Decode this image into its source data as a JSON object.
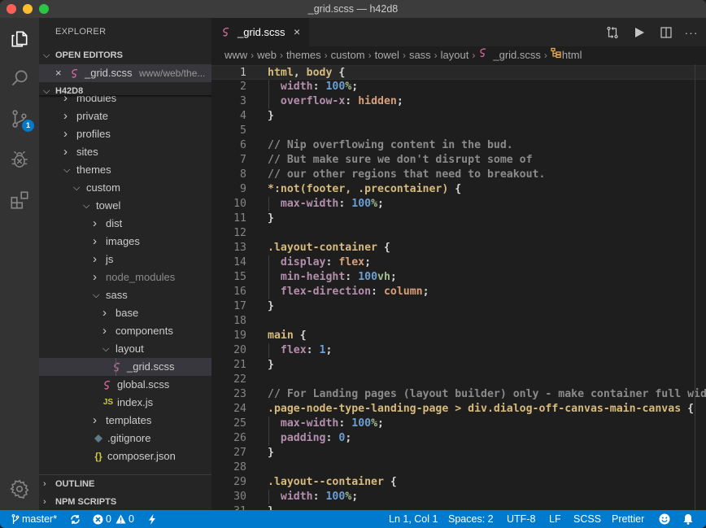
{
  "window": {
    "title": "_grid.scss — h42d8"
  },
  "activity_bar": {
    "items": [
      {
        "name": "explorer",
        "icon": "files-icon"
      },
      {
        "name": "search",
        "icon": "search-icon"
      },
      {
        "name": "source-control",
        "icon": "source-control-icon",
        "badge": "1"
      },
      {
        "name": "debug",
        "icon": "debug-icon"
      },
      {
        "name": "extensions",
        "icon": "extensions-icon"
      }
    ],
    "bottom": {
      "name": "manage",
      "icon": "gear-icon"
    }
  },
  "sidebar": {
    "title": "EXPLORER",
    "open_editors": {
      "header": "OPEN EDITORS",
      "items": [
        {
          "name": "_grid.scss",
          "path": "www/web/the...",
          "icon": "sass-icon"
        }
      ]
    },
    "folder": {
      "header": "H42D8",
      "tree": [
        {
          "label": "modules",
          "type": "folder",
          "expanded": false,
          "depth": 1
        },
        {
          "label": "private",
          "type": "folder",
          "expanded": false,
          "depth": 1
        },
        {
          "label": "profiles",
          "type": "folder",
          "expanded": false,
          "depth": 1
        },
        {
          "label": "sites",
          "type": "folder",
          "expanded": false,
          "depth": 1
        },
        {
          "label": "themes",
          "type": "folder",
          "expanded": true,
          "depth": 1
        },
        {
          "label": "custom",
          "type": "folder",
          "expanded": true,
          "depth": 2
        },
        {
          "label": "towel",
          "type": "folder",
          "expanded": true,
          "depth": 3
        },
        {
          "label": "dist",
          "type": "folder",
          "expanded": false,
          "depth": 4
        },
        {
          "label": "images",
          "type": "folder",
          "expanded": false,
          "depth": 4
        },
        {
          "label": "js",
          "type": "folder",
          "expanded": false,
          "depth": 4
        },
        {
          "label": "node_modules",
          "type": "folder",
          "expanded": false,
          "depth": 4,
          "dimmed": true
        },
        {
          "label": "sass",
          "type": "folder",
          "expanded": true,
          "depth": 4
        },
        {
          "label": "base",
          "type": "folder",
          "expanded": false,
          "depth": 5
        },
        {
          "label": "components",
          "type": "folder",
          "expanded": false,
          "depth": 5
        },
        {
          "label": "layout",
          "type": "folder",
          "expanded": true,
          "depth": 5
        },
        {
          "label": "_grid.scss",
          "type": "scss",
          "depth": 6,
          "selected": true
        },
        {
          "label": "global.scss",
          "type": "scss",
          "depth": 5
        },
        {
          "label": "index.js",
          "type": "js",
          "depth": 5
        },
        {
          "label": "templates",
          "type": "folder",
          "expanded": false,
          "depth": 4
        },
        {
          "label": ".gitignore",
          "type": "git",
          "depth": 4
        },
        {
          "label": "composer.json",
          "type": "json",
          "depth": 4
        }
      ]
    },
    "outline": {
      "header": "OUTLINE"
    },
    "npm_scripts": {
      "header": "NPM SCRIPTS"
    }
  },
  "editor": {
    "tab": {
      "name": "_grid.scss",
      "icon": "sass-icon"
    },
    "actions": [
      {
        "name": "open-changes",
        "icon": "git-compare-icon"
      },
      {
        "name": "run",
        "icon": "play-icon"
      },
      {
        "name": "split-editor",
        "icon": "split-editor-icon"
      },
      {
        "name": "more-actions",
        "icon": "ellipsis-icon"
      }
    ],
    "breadcrumb": [
      "www",
      "web",
      "themes",
      "custom",
      "towel",
      "sass",
      "layout",
      "_grid.scss",
      "html"
    ],
    "current_line": 1,
    "lines": [
      [
        [
          "sel",
          "html"
        ],
        [
          "pun",
          ", "
        ],
        [
          "sel",
          "body"
        ],
        [
          "pun",
          " {"
        ]
      ],
      [
        [
          "pun",
          "  "
        ],
        [
          "prop",
          "width"
        ],
        [
          "pun",
          ": "
        ],
        [
          "num",
          "100"
        ],
        [
          "unit",
          "%"
        ],
        [
          "pun",
          ";"
        ]
      ],
      [
        [
          "pun",
          "  "
        ],
        [
          "prop",
          "overflow-x"
        ],
        [
          "pun",
          ": "
        ],
        [
          "val",
          "hidden"
        ],
        [
          "pun",
          ";"
        ]
      ],
      [
        [
          "pun",
          "}"
        ]
      ],
      [],
      [
        [
          "com",
          "// Nip overflowing content in the bud."
        ]
      ],
      [
        [
          "com",
          "// But make sure we don't disrupt some of"
        ]
      ],
      [
        [
          "com",
          "// our other regions that need to breakout."
        ]
      ],
      [
        [
          "sel",
          "*:not(footer, .precontainer)"
        ],
        [
          "pun",
          " {"
        ]
      ],
      [
        [
          "pun",
          "  "
        ],
        [
          "prop",
          "max-width"
        ],
        [
          "pun",
          ": "
        ],
        [
          "num",
          "100"
        ],
        [
          "unit",
          "%"
        ],
        [
          "pun",
          ";"
        ]
      ],
      [
        [
          "pun",
          "}"
        ]
      ],
      [],
      [
        [
          "sel",
          ".layout-container"
        ],
        [
          "pun",
          " {"
        ]
      ],
      [
        [
          "pun",
          "  "
        ],
        [
          "prop",
          "display"
        ],
        [
          "pun",
          ": "
        ],
        [
          "val",
          "flex"
        ],
        [
          "pun",
          ";"
        ]
      ],
      [
        [
          "pun",
          "  "
        ],
        [
          "prop",
          "min-height"
        ],
        [
          "pun",
          ": "
        ],
        [
          "num",
          "100"
        ],
        [
          "unit",
          "vh"
        ],
        [
          "pun",
          ";"
        ]
      ],
      [
        [
          "pun",
          "  "
        ],
        [
          "prop",
          "flex-direction"
        ],
        [
          "pun",
          ": "
        ],
        [
          "val",
          "column"
        ],
        [
          "pun",
          ";"
        ]
      ],
      [
        [
          "pun",
          "}"
        ]
      ],
      [],
      [
        [
          "sel",
          "main"
        ],
        [
          "pun",
          " {"
        ]
      ],
      [
        [
          "pun",
          "  "
        ],
        [
          "prop",
          "flex"
        ],
        [
          "pun",
          ": "
        ],
        [
          "num",
          "1"
        ],
        [
          "pun",
          ";"
        ]
      ],
      [
        [
          "pun",
          "}"
        ]
      ],
      [],
      [
        [
          "com",
          "// For Landing pages (layout builder) only - make container full width"
        ]
      ],
      [
        [
          "sel",
          ".page-node-type-landing-page > div.dialog-off-canvas-main-canvas"
        ],
        [
          "pun",
          " {"
        ]
      ],
      [
        [
          "pun",
          "  "
        ],
        [
          "prop",
          "max-width"
        ],
        [
          "pun",
          ": "
        ],
        [
          "num",
          "100"
        ],
        [
          "unit",
          "%"
        ],
        [
          "pun",
          ";"
        ]
      ],
      [
        [
          "pun",
          "  "
        ],
        [
          "prop",
          "padding"
        ],
        [
          "pun",
          ": "
        ],
        [
          "num",
          "0"
        ],
        [
          "pun",
          ";"
        ]
      ],
      [
        [
          "pun",
          "}"
        ]
      ],
      [],
      [
        [
          "sel",
          ".layout--container"
        ],
        [
          "pun",
          " {"
        ]
      ],
      [
        [
          "pun",
          "  "
        ],
        [
          "prop",
          "width"
        ],
        [
          "pun",
          ": "
        ],
        [
          "num",
          "100"
        ],
        [
          "unit",
          "%"
        ],
        [
          "pun",
          ";"
        ]
      ],
      [
        [
          "pun",
          "}"
        ]
      ]
    ]
  },
  "status_bar": {
    "branch": "master*",
    "errors": "0",
    "warnings": "0",
    "position": "Ln 1, Col 1",
    "indentation": "Spaces: 2",
    "encoding": "UTF-8",
    "eol": "LF",
    "language": "SCSS",
    "formatter": "Prettier"
  },
  "colors": {
    "accent": "#007acc",
    "sass_icon": "#cd6799",
    "js_icon": "#cbcb41",
    "json_icon": "#cbcb41",
    "git_icon": "#41535b"
  }
}
